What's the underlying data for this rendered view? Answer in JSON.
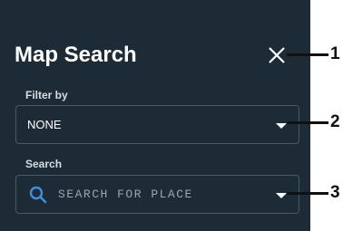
{
  "panel": {
    "title": "Map Search",
    "filter": {
      "label": "Filter by",
      "selected_value": "NONE"
    },
    "search": {
      "label": "Search",
      "placeholder": "SEARCH FOR PLACE"
    }
  },
  "callouts": [
    "1",
    "2",
    "3"
  ],
  "colors": {
    "panel_background": "#1c2b36",
    "field_border": "#4a5864",
    "search_icon": "#3f8fe0",
    "text": "#ffffff"
  },
  "icons": {
    "close": "close-icon",
    "search": "search-icon",
    "dropdown": "chevron-down-icon"
  }
}
